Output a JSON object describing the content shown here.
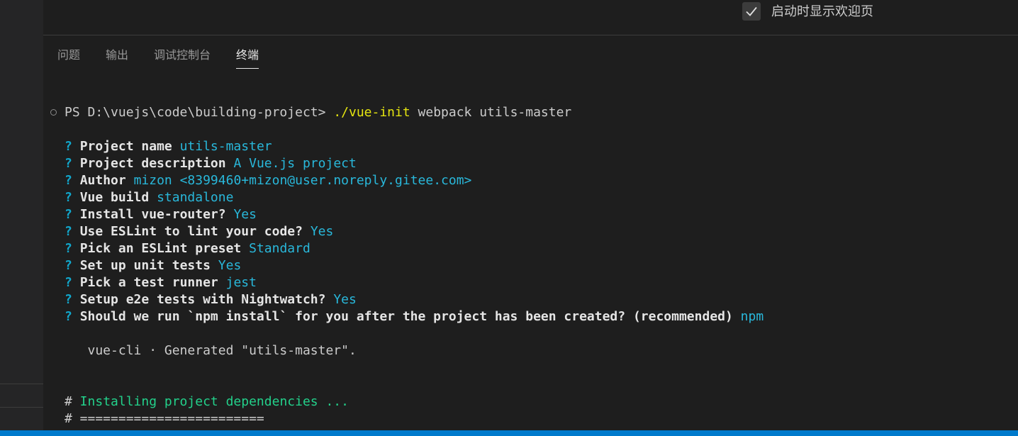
{
  "welcome": {
    "checkbox_checked": true,
    "startup_label": "启动时显示欢迎页"
  },
  "panel": {
    "tabs": [
      {
        "label": "问题"
      },
      {
        "label": "输出"
      },
      {
        "label": "调试控制台"
      },
      {
        "label": "终端",
        "active": true
      }
    ]
  },
  "terminal": {
    "prompt": "PS D:\\vuejs\\code\\building-project>",
    "command_exec": "./vue-init",
    "command_args": " webpack utils-master",
    "questions": [
      {
        "prompt": "Project name",
        "answer": "utils-master"
      },
      {
        "prompt": "Project description",
        "answer": "A Vue.js project"
      },
      {
        "prompt": "Author",
        "answer": "mizon <8399460+mizon@user.noreply.gitee.com>"
      },
      {
        "prompt": "Vue build",
        "answer": "standalone"
      },
      {
        "prompt": "Install vue-router?",
        "answer": "Yes"
      },
      {
        "prompt": "Use ESLint to lint your code?",
        "answer": "Yes"
      },
      {
        "prompt": "Pick an ESLint preset",
        "answer": "Standard"
      },
      {
        "prompt": "Set up unit tests",
        "answer": "Yes"
      },
      {
        "prompt": "Pick a test runner",
        "answer": "jest"
      },
      {
        "prompt": "Setup e2e tests with Nightwatch?",
        "answer": "Yes"
      },
      {
        "prompt": "Should we run `npm install` for you after the project has been created? (recommended)",
        "answer": "npm"
      }
    ],
    "generated_line": "   vue-cli · Generated \"utils-master\".",
    "installing_hash": "#",
    "installing_text": " Installing project dependencies ...",
    "separator_line": "# ========================"
  },
  "colors": {
    "background": "#1e1e1e",
    "question_mark": "#11a8cd",
    "answer": "#29b8db",
    "command": "#e5e510",
    "installing": "#23d18b",
    "status_bar": "#007acc"
  }
}
